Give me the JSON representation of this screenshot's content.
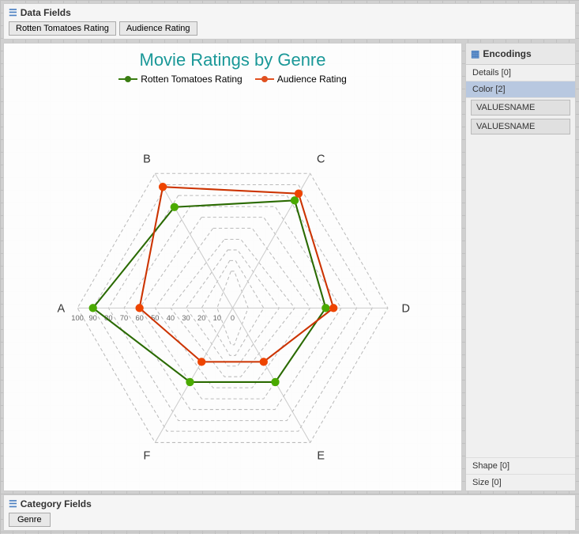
{
  "dataFields": {
    "header": "Data Fields",
    "tags": [
      "Rotten Tomatoes Rating",
      "Audience Rating"
    ]
  },
  "chart": {
    "title": "Movie Ratings by Genre",
    "legend": {
      "series1": "Rotten Tomatoes Rating",
      "series2": "Audience Rating"
    },
    "axes": [
      "A",
      "B",
      "C",
      "D",
      "E",
      "F"
    ],
    "radialLabels": [
      "100",
      "90",
      "80",
      "70",
      "60",
      "50",
      "40",
      "30",
      "20",
      "10",
      "0"
    ]
  },
  "encodings": {
    "header": "Encodings",
    "rows": [
      {
        "label": "Details [0]",
        "active": false
      },
      {
        "label": "Color [2]",
        "active": true
      },
      {
        "label": "VALUESNAME",
        "type": "value"
      },
      {
        "label": "VALUESNAME",
        "type": "value"
      },
      {
        "label": "Shape [0]",
        "active": false
      },
      {
        "label": "Size [0]",
        "active": false
      }
    ]
  },
  "categoryFields": {
    "header": "Category Fields",
    "tags": [
      "Genre"
    ]
  }
}
